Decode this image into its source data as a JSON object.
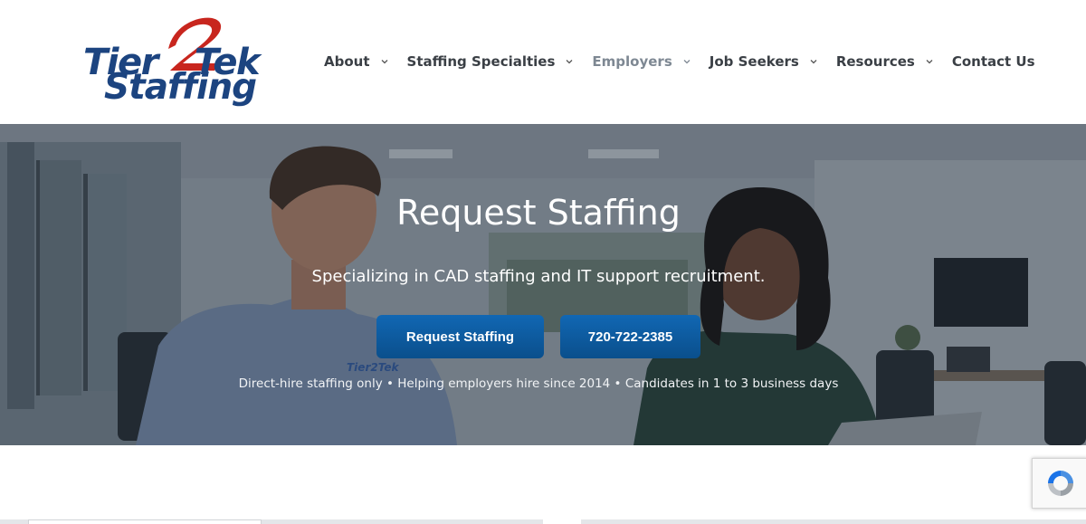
{
  "logo": {
    "line1_a": "Tier",
    "line1_two": "2",
    "line1_b": "Tek",
    "line2": "Staffing"
  },
  "nav": {
    "items": [
      {
        "label": "About",
        "has_dropdown": true,
        "active": false
      },
      {
        "label": "Staffing Specialties",
        "has_dropdown": true,
        "active": false
      },
      {
        "label": "Employers",
        "has_dropdown": true,
        "active": true
      },
      {
        "label": "Job Seekers",
        "has_dropdown": true,
        "active": false
      },
      {
        "label": "Resources",
        "has_dropdown": true,
        "active": false
      },
      {
        "label": "Contact Us",
        "has_dropdown": false,
        "active": false
      }
    ]
  },
  "hero": {
    "title": "Request Staffing",
    "subtitle": "Specializing in CAD staffing and IT support recruitment.",
    "primary_button": "Request Staffing",
    "phone_button": "720-722-2385",
    "note": "Direct-hire staffing only • Helping employers hire since 2014 • Candidates in 1 to 3 business days",
    "shirt_logo_text": "Tier2Tek"
  },
  "colors": {
    "brand_blue": "#1c4480",
    "brand_red": "#c8261e",
    "button_blue": "#0f5fa6",
    "nav_text": "#3a3f45",
    "nav_active": "#7e8893"
  },
  "icons": {
    "dropdown": "chevron-down-icon",
    "recaptcha": "recaptcha-icon"
  }
}
